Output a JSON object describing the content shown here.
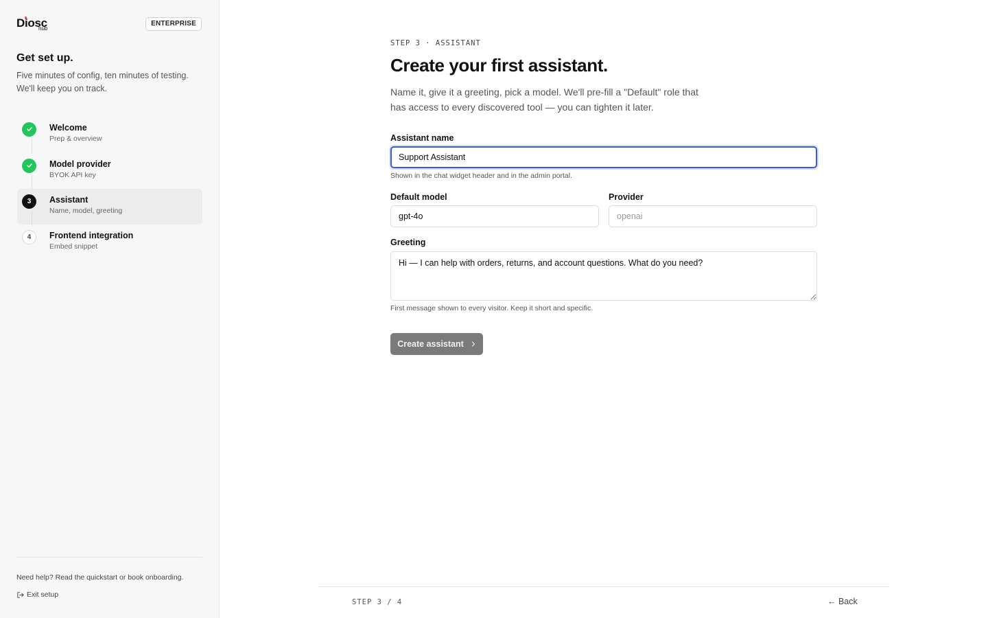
{
  "brand": {
    "name": "Diosc",
    "sub": "hub"
  },
  "badge": "ENTERPRISE",
  "sidebar": {
    "title": "Get set up.",
    "subtitle": "Five minutes of config, ten minutes of testing. We'll keep you on track.",
    "steps": [
      {
        "number": "1",
        "title": "Welcome",
        "desc": "Prep & overview",
        "status": "done"
      },
      {
        "number": "2",
        "title": "Model provider",
        "desc": "BYOK API key",
        "status": "done"
      },
      {
        "number": "3",
        "title": "Assistant",
        "desc": "Name, model, greeting",
        "status": "current"
      },
      {
        "number": "4",
        "title": "Frontend integration",
        "desc": "Embed snippet",
        "status": "todo"
      }
    ],
    "help": "Need help? Read the quickstart or book onboarding.",
    "exit": "Exit setup"
  },
  "main": {
    "eyebrow": "STEP 3 · ASSISTANT",
    "title": "Create your first assistant.",
    "lead": "Name it, give it a greeting, pick a model. We'll pre-fill a \"Default\" role that has access to every discovered tool — you can tighten it later.",
    "assistant_name": {
      "label": "Assistant name",
      "value": "Support Assistant",
      "hint": "Shown in the chat widget header and in the admin portal."
    },
    "default_model": {
      "label": "Default model",
      "value": "gpt-4o"
    },
    "provider": {
      "label": "Provider",
      "value": "openai"
    },
    "greeting": {
      "label": "Greeting",
      "value": "Hi — I can help with orders, returns, and account questions. What do you need?",
      "hint": "First message shown to every visitor. Keep it short and specific."
    },
    "create_button": "Create assistant"
  },
  "footer": {
    "step": "STEP 3 / 4",
    "back": "← Back"
  },
  "colors": {
    "done": "#22c55e",
    "current": "#111111",
    "focus": "#3b5bd9",
    "button": "#7a7a7a"
  }
}
